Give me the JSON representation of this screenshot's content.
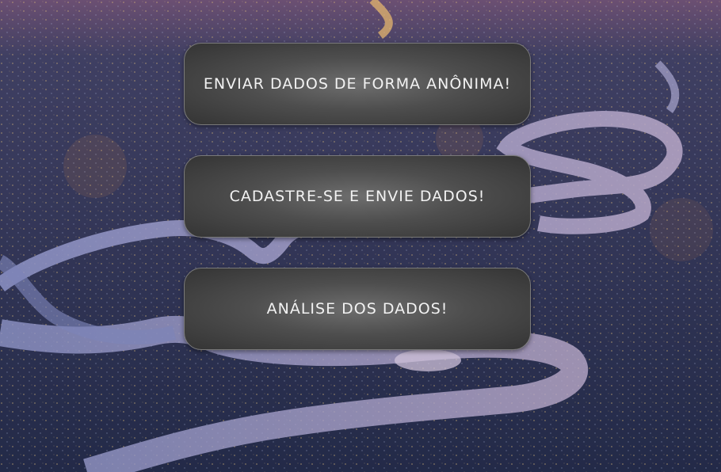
{
  "background": {
    "description_icon": "city-night-aerial-image",
    "sky_color": "#6b4f72",
    "city_color": "#2b3150",
    "river_color": "#8f93c4"
  },
  "buttons": [
    {
      "label": "Enviar dados de forma anônima!"
    },
    {
      "label": "Cadastre-se e envie dados!"
    },
    {
      "label": "Análise dos dados!"
    }
  ]
}
